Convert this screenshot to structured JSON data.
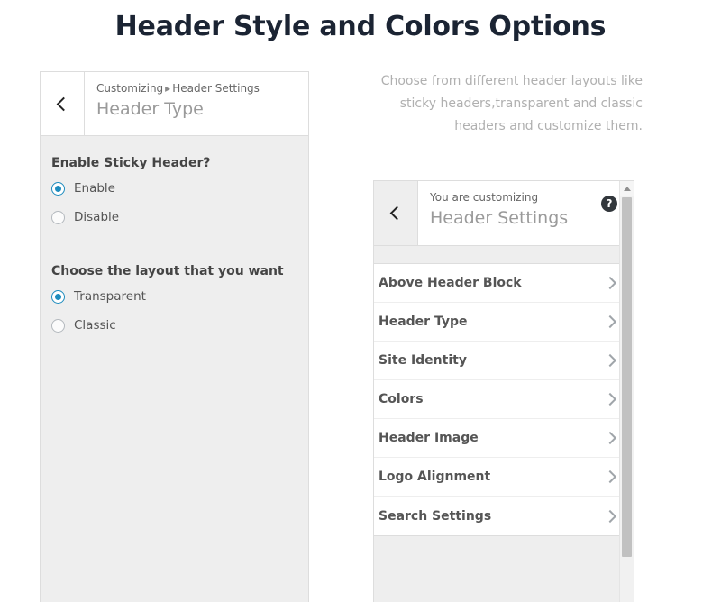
{
  "page": {
    "title": "Header Style and Colors Options",
    "description": "Choose from different header layouts like sticky headers,transparent and classic headers and customize them."
  },
  "left_panel": {
    "back_icon": "chevron-left-icon",
    "breadcrumb_root": "Customizing",
    "breadcrumb_separator": "▸",
    "breadcrumb_section": "Header Settings",
    "title": "Header Type",
    "controls": [
      {
        "label": "Enable Sticky Header?",
        "options": [
          {
            "label": "Enable",
            "checked": true
          },
          {
            "label": "Disable",
            "checked": false
          }
        ]
      },
      {
        "label": "Choose the layout that you want",
        "options": [
          {
            "label": "Transparent",
            "checked": true
          },
          {
            "label": "Classic",
            "checked": false
          }
        ]
      }
    ]
  },
  "right_panel": {
    "back_icon": "chevron-left-icon",
    "eyebrow": "You are customizing",
    "title": "Header Settings",
    "help_icon": "?",
    "menu_items": [
      {
        "label": "Above Header Block",
        "chevron": "chevron-right-icon"
      },
      {
        "label": "Header Type",
        "chevron": "chevron-right-icon"
      },
      {
        "label": "Site Identity",
        "chevron": "chevron-right-icon"
      },
      {
        "label": "Colors",
        "chevron": "chevron-right-icon"
      },
      {
        "label": "Header Image",
        "chevron": "chevron-right-icon"
      },
      {
        "label": "Logo Alignment",
        "chevron": "chevron-right-icon"
      },
      {
        "label": "Search Settings",
        "chevron": "chevron-right-icon"
      }
    ]
  },
  "colors": {
    "title_color": "#1b2433",
    "accent_blue": "#1e8cbe",
    "panel_bg": "#eeeeee",
    "muted_text": "#b0b0b0"
  }
}
